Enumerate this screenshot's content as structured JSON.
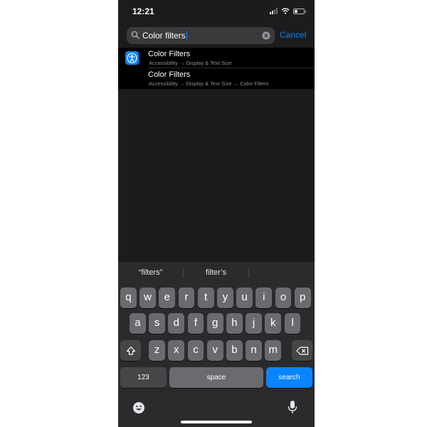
{
  "status_bar": {
    "time": "12:21"
  },
  "search": {
    "query": "Color filters",
    "cancel_label": "Cancel"
  },
  "results": [
    {
      "title": "Color Filters",
      "path": "Accessibility → Display & Text Size",
      "has_icon": true
    },
    {
      "title": "Color Filters",
      "path": "Accessibility → Display & Text Size → Color Filters",
      "has_icon": false
    }
  ],
  "keyboard": {
    "suggestions": [
      "“filters”",
      "filter’s"
    ],
    "row1": [
      "q",
      "w",
      "e",
      "r",
      "t",
      "y",
      "u",
      "i",
      "o",
      "p"
    ],
    "row2": [
      "a",
      "s",
      "d",
      "f",
      "g",
      "h",
      "j",
      "k",
      "l"
    ],
    "row3": [
      "z",
      "x",
      "c",
      "v",
      "b",
      "n",
      "m"
    ],
    "numbers_label": "123",
    "space_label": "space",
    "search_label": "search"
  },
  "colors": {
    "accent": "#0a84ff",
    "background": "#1c1c1e",
    "key": "#6b6b6f"
  },
  "icons": [
    "search-icon",
    "clear-icon",
    "accessibility-icon",
    "shift-icon",
    "delete-icon",
    "emoji-icon",
    "mic-icon"
  ]
}
